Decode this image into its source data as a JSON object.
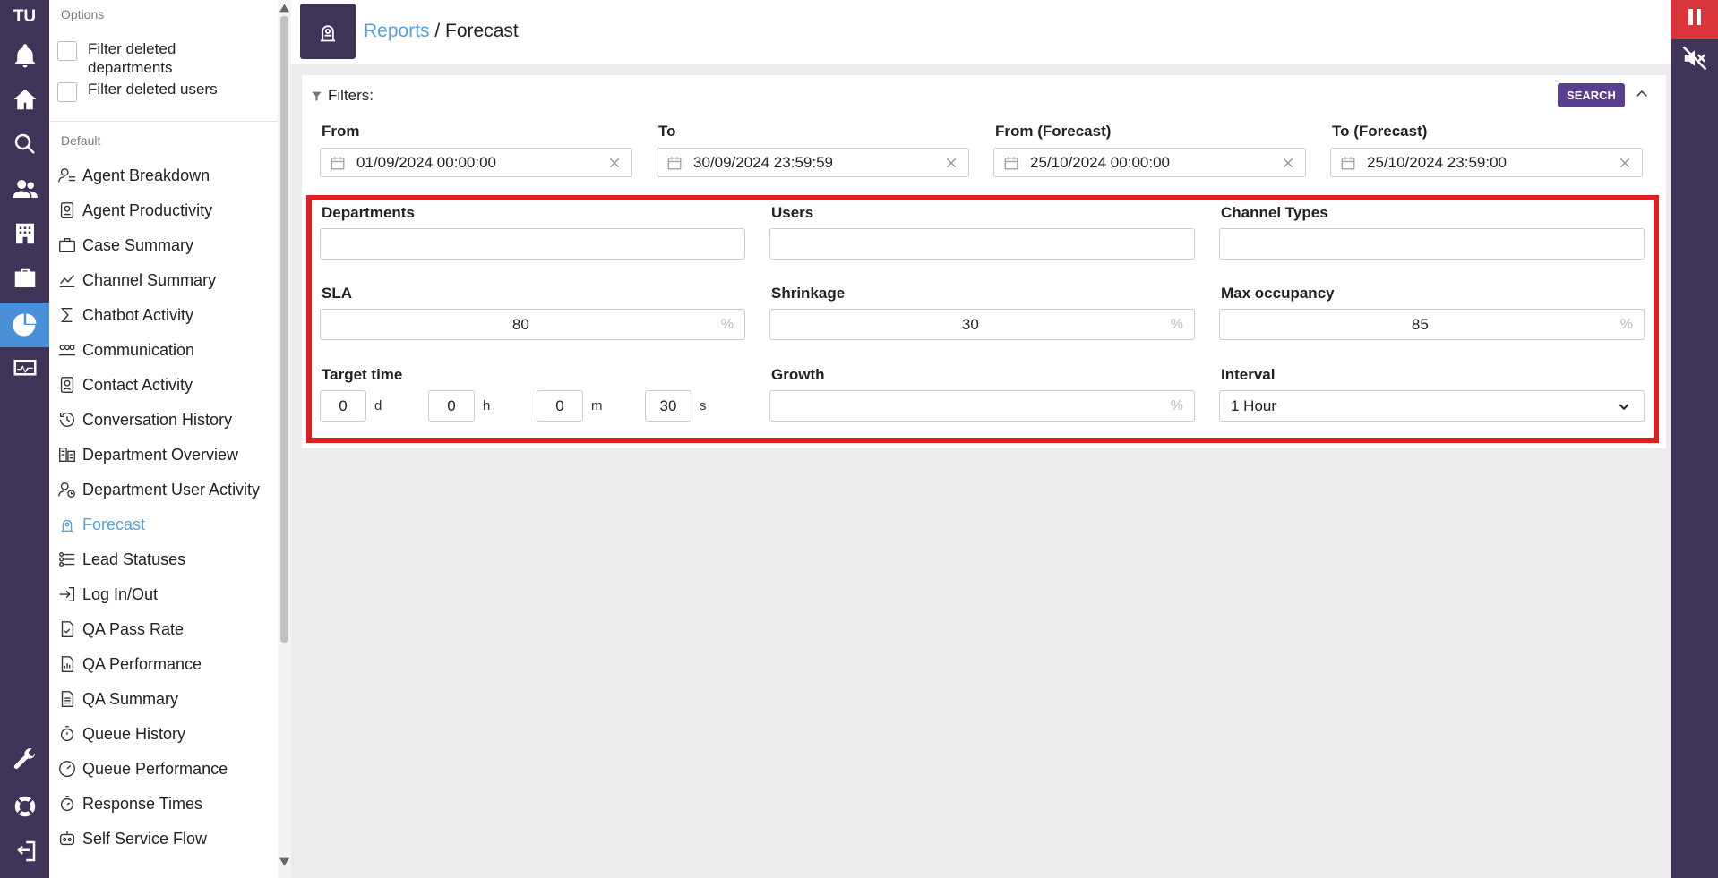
{
  "rail": {
    "initials": "TU",
    "icons": [
      "bell-icon",
      "home-icon",
      "search-icon",
      "users-icon",
      "building-icon",
      "briefcase-icon",
      "pie-chart-icon",
      "monitor-icon",
      "wrench-icon",
      "lifebuoy-icon",
      "logout-icon"
    ],
    "active_icon": "pie-chart-icon"
  },
  "options": {
    "title": "Options",
    "filter_departments": "Filter deleted departments",
    "filter_users": "Filter deleted users"
  },
  "nav": {
    "section": "Default",
    "items": [
      "Agent Breakdown",
      "Agent Productivity",
      "Case Summary",
      "Channel Summary",
      "Chatbot Activity",
      "Communication",
      "Contact Activity",
      "Conversation History",
      "Department Overview",
      "Department User Activity",
      "Forecast",
      "Lead Statuses",
      "Log In/Out",
      "QA Pass Rate",
      "QA Performance",
      "QA Summary",
      "Queue History",
      "Queue Performance",
      "Response Times",
      "Self Service Flow"
    ],
    "active": "Forecast"
  },
  "header": {
    "crumb_link": "Reports",
    "separator": " / ",
    "crumb_current": "Forecast"
  },
  "filters": {
    "title": "Filters:",
    "search_label": "SEARCH",
    "from_label": "From",
    "from_value": "01/09/2024 00:00:00",
    "to_label": "To",
    "to_value": "30/09/2024 23:59:59",
    "from_forecast_label": "From (Forecast)",
    "from_forecast_value": "25/10/2024 00:00:00",
    "to_forecast_label": "To (Forecast)",
    "to_forecast_value": "25/10/2024 23:59:00",
    "departments_label": "Departments",
    "departments_value": "",
    "users_label": "Users",
    "users_value": "",
    "channel_types_label": "Channel Types",
    "channel_types_value": "",
    "sla_label": "SLA",
    "sla_value": "80",
    "shrinkage_label": "Shrinkage",
    "shrinkage_value": "30",
    "max_occupancy_label": "Max occupancy",
    "max_occupancy_value": "85",
    "percent_symbol": "%",
    "target_time_label": "Target time",
    "target_days": "0",
    "target_hours": "0",
    "target_minutes": "0",
    "target_seconds": "30",
    "unit_d": "d",
    "unit_h": "h",
    "unit_m": "m",
    "unit_s": "s",
    "growth_label": "Growth",
    "growth_value": "",
    "interval_label": "Interval",
    "interval_value": "1 Hour"
  },
  "colors": {
    "rail_bg": "#3f3357",
    "accent_link": "#5aa0d8",
    "search_button": "#5a3e8f",
    "highlight_border": "#e02020"
  }
}
